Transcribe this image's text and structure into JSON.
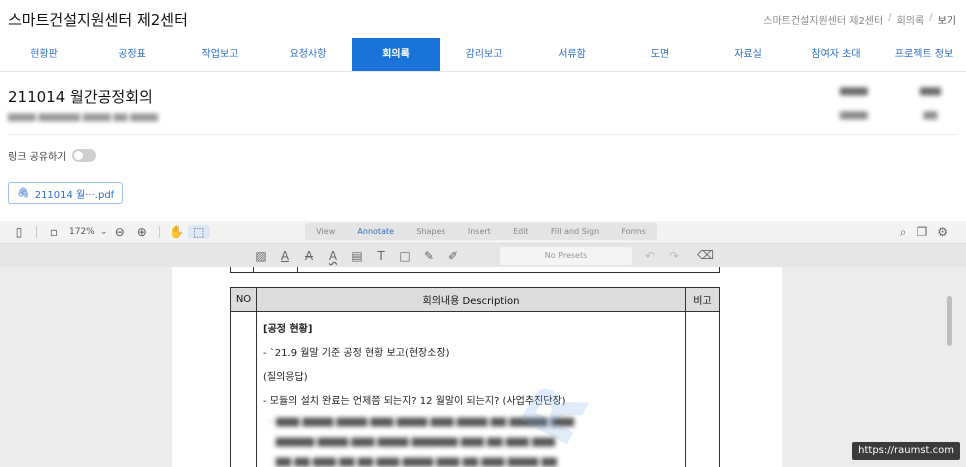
{
  "header": {
    "title": "스마트건설지원센터 제2센터",
    "breadcrumb": [
      "스마트건설지원센터 제2센터",
      "회의록",
      "보기"
    ]
  },
  "nav": {
    "items": [
      "현황판",
      "공정표",
      "작업보고",
      "요청사항",
      "회의록",
      "감리보고",
      "서류함",
      "도면",
      "자료실",
      "참여자 초대",
      "프로젝트 정보"
    ],
    "active_index": 4
  },
  "meeting": {
    "title": "211014 월간공정회의"
  },
  "share": {
    "label": "링크 공유하기",
    "enabled": false
  },
  "attachment": {
    "filename": "211014 월···.pdf"
  },
  "viewer": {
    "zoom": "172%",
    "mode_tabs": [
      "View",
      "Annotate",
      "Shapes",
      "Insert",
      "Edit",
      "Fill and Sign",
      "Forms"
    ],
    "active_mode": "Annotate",
    "presets": "No Presets"
  },
  "document_table": {
    "headers": [
      "NO",
      "회의내용 Description",
      "비고"
    ],
    "lines": [
      {
        "text": "[공정 현황]",
        "bold": true
      },
      {
        "text": "- `21.9 월말 기준 공정 현황 보고(현장소장)",
        "bold": false
      },
      {
        "text": "(질의응답)",
        "bold": false
      },
      {
        "text": "- 모듈의 설치 완료는 언제쯤 되는지? 12 월말이 되는지? (사업추진단장)",
        "bold": false
      }
    ]
  },
  "url_badge": "https://raumst.com"
}
